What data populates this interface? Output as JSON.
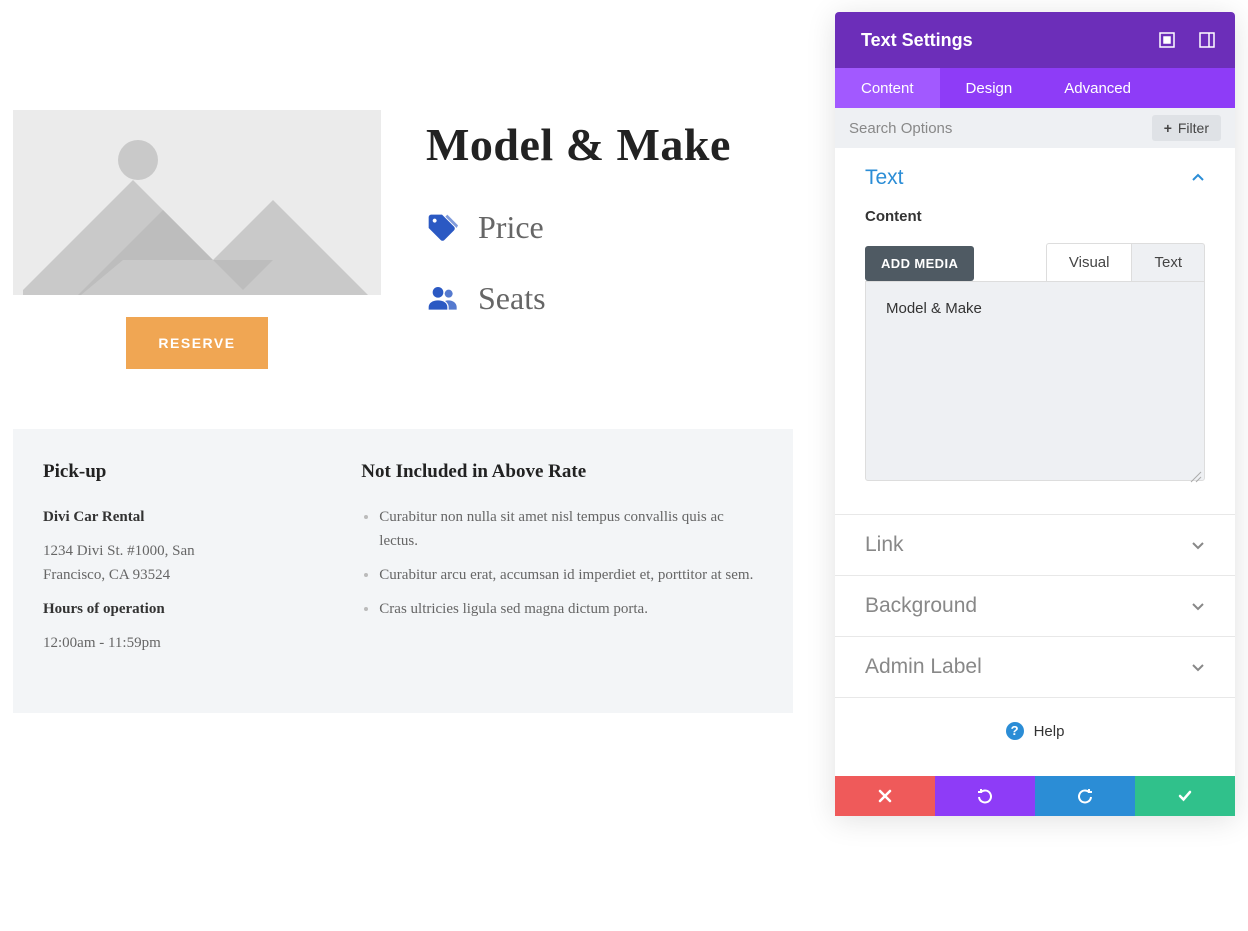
{
  "preview": {
    "title": "Model & Make",
    "features": {
      "price": "Price",
      "seats": "Seats"
    },
    "reserve_label": "RESERVE",
    "pickup": {
      "heading": "Pick-up",
      "company": "Divi Car Rental",
      "address": "1234 Divi St. #1000, San Francisco, CA 93524",
      "hours_label": "Hours of operation",
      "hours": "12:00am - 11:59pm"
    },
    "not_included": {
      "heading": "Not Included in Above Rate",
      "items": [
        "Curabitur non nulla sit amet nisl tempus convallis quis ac lectus.",
        "Curabitur arcu erat, accumsan id imperdiet et, porttitor at sem.",
        "Cras ultricies ligula sed magna dictum porta."
      ]
    }
  },
  "panel": {
    "title": "Text Settings",
    "tabs": {
      "content": "Content",
      "design": "Design",
      "advanced": "Advanced"
    },
    "search_placeholder": "Search Options",
    "filter_label": "Filter",
    "sections": {
      "text": "Text",
      "link": "Link",
      "background": "Background",
      "admin_label": "Admin Label"
    },
    "content_label": "Content",
    "add_media": "ADD MEDIA",
    "editor_tabs": {
      "visual": "Visual",
      "text": "Text"
    },
    "editor_content": "Model & Make",
    "help_label": "Help",
    "colors": {
      "header": "#6c2eb9",
      "tabs_bg": "#8e3cf7",
      "tab_active": "#a259ff",
      "accent_blue": "#2b8dd6",
      "cancel": "#ef5a5a",
      "save": "#30c18b"
    }
  }
}
